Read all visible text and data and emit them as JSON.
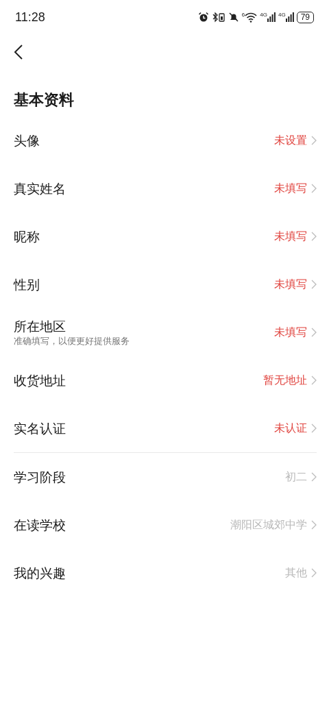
{
  "status_bar": {
    "time": "11:28",
    "wifi_label": "6",
    "signals": [
      "4G",
      "4G"
    ],
    "battery": "79"
  },
  "title": "基本资料",
  "sections": [
    {
      "rows": [
        {
          "label": "头像",
          "value": "未设置",
          "filled": false
        },
        {
          "label": "真实姓名",
          "value": "未填写",
          "filled": false
        },
        {
          "label": "昵称",
          "value": "未填写",
          "filled": false
        },
        {
          "label": "性别",
          "value": "未填写",
          "filled": false
        },
        {
          "label": "所在地区",
          "hint": "准确填写，以便更好提供服务",
          "value": "未填写",
          "filled": false
        },
        {
          "label": "收货地址",
          "value": "暂无地址",
          "filled": false
        },
        {
          "label": "实名认证",
          "value": "未认证",
          "filled": false
        }
      ]
    },
    {
      "rows": [
        {
          "label": "学习阶段",
          "value": "初二",
          "filled": true
        },
        {
          "label": "在读学校",
          "value": "潮阳区城郊中学",
          "filled": true
        },
        {
          "label": "我的兴趣",
          "value": "其他",
          "filled": true
        }
      ]
    }
  ]
}
